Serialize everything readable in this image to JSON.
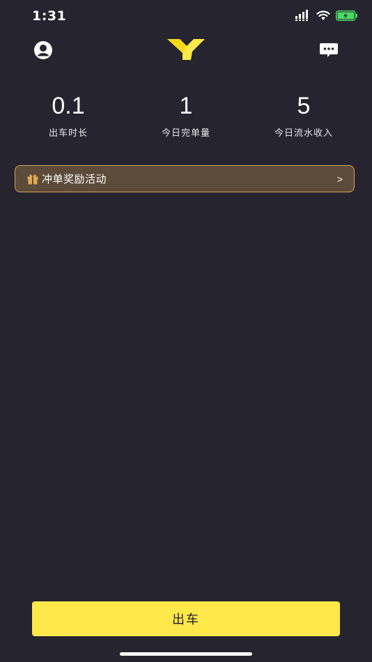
{
  "status_bar": {
    "time": "1:31"
  },
  "header": {
    "logo_icon": "y-logo-icon",
    "profile_icon": "user-avatar-icon",
    "message_icon": "chat-bubble-icon"
  },
  "stats": [
    {
      "value": "0.1",
      "label": "出车时长"
    },
    {
      "value": "1",
      "label": "今日完单量"
    },
    {
      "value": "5",
      "label": "今日流水收入"
    }
  ],
  "reward_banner": {
    "label": "冲单奖励活动",
    "chevron": ">",
    "icon": "gift-icon"
  },
  "start_button": {
    "label": "出车"
  },
  "colors": {
    "background": "#25242f",
    "accent_yellow": "#ffe84a",
    "banner_border": "#d8a35a",
    "banner_fill": "#5d4b3a",
    "battery_green": "#4cd964"
  }
}
